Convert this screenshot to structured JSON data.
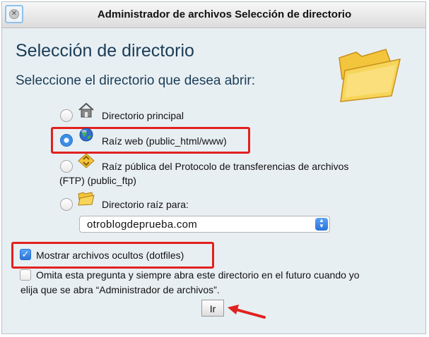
{
  "window": {
    "title": "Administrador de archivos Selección de directorio"
  },
  "main": {
    "heading": "Selección de directorio",
    "subheading": "Seleccione el directorio que desea abrir:"
  },
  "options": [
    {
      "label": "Directorio principal",
      "icon": "home-icon",
      "checked": false
    },
    {
      "label": "Raíz web (public_html/www)",
      "icon": "globe-icon",
      "checked": true
    },
    {
      "label_line1": "Raíz pública del Protocolo de transferencias de archivos",
      "label_line2": "(FTP) (public_ftp)",
      "icon": "ftp-icon",
      "checked": false
    },
    {
      "label": "Directorio raíz para:",
      "icon": "folder-icon",
      "checked": false
    }
  ],
  "domain_select": {
    "value": "otroblogdeprueba.com"
  },
  "show_hidden": {
    "label": "Mostrar archivos ocultos (dotfiles)",
    "checked": true
  },
  "skip_question": {
    "line1": "Omita esta pregunta y siempre abra este directorio en el futuro cuando yo",
    "line2": "elija que se abra “Administrador de archivos”.",
    "checked": false
  },
  "go_button": {
    "label": "Ir"
  },
  "colors": {
    "highlight": "#e1211f",
    "accent": "#2a74d8",
    "heading": "#1a3d57"
  }
}
